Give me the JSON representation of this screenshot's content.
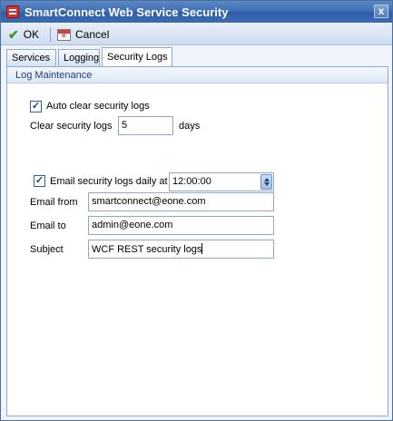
{
  "window": {
    "title": "SmartConnect Web Service Security",
    "close_glyph": "x"
  },
  "toolbar": {
    "ok_label": "OK",
    "cancel_label": "Cancel"
  },
  "tabs": [
    {
      "label": "Services",
      "active": false
    },
    {
      "label": "Logging",
      "active": false
    },
    {
      "label": "Security Logs",
      "active": true
    }
  ],
  "log_maintenance": {
    "header": "Log Maintenance",
    "auto_clear_label": "Auto clear security logs",
    "auto_clear_checked": true,
    "clear_logs_label": "Clear security logs",
    "clear_logs_value": "5",
    "clear_logs_unit": "days",
    "email_daily_label": "Email security logs daily at",
    "email_daily_checked": true,
    "email_time_value": "12:00:00",
    "email_from_label": "Email from",
    "email_from_value": "smartconnect@eone.com",
    "email_to_label": "Email to",
    "email_to_value": "admin@eone.com",
    "subject_label": "Subject",
    "subject_value": "WCF REST security logs"
  },
  "colors": {
    "title_bar": "#3e6fb5",
    "group_header_text": "#1e3e7a",
    "checkbox_border": "#2f5ea8"
  }
}
